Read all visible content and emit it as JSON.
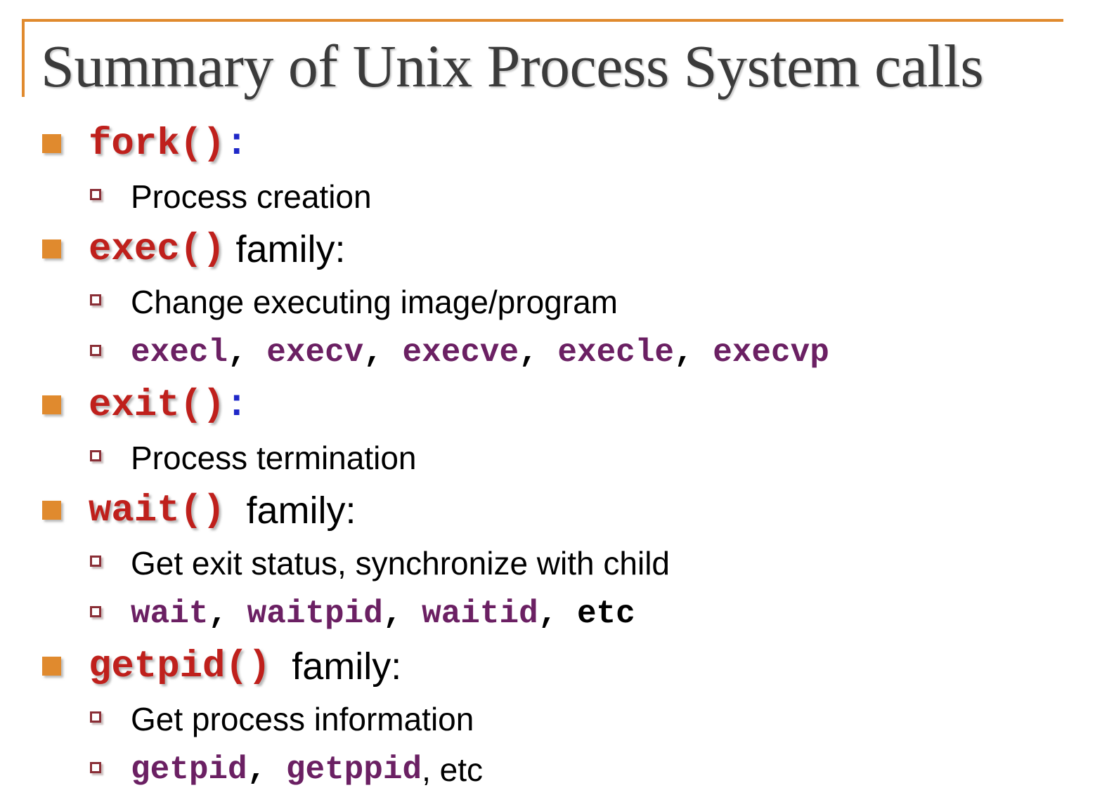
{
  "slide": {
    "title": "Summary of Unix Process System calls",
    "accent_color": "#E08A2E",
    "title_color": "#3B3B3B",
    "code_red_color": "#BF201C",
    "code_purple_color": "#6B2063",
    "colon_blue_color": "#1F28C8",
    "bullet_l1_color": "#E08A2E",
    "bullet_l2_color": "#8A2E36",
    "background_color": "#FFFFFF"
  },
  "outline": {
    "fork": {
      "call": "fork()",
      "colon": ":",
      "sub1": "Process creation"
    },
    "exec": {
      "call": "exec()",
      "suffix": " family:",
      "sub1": "Change executing image/program",
      "sub2": {
        "a": "execl",
        "sep1": ", ",
        "b": "execv",
        "sep2": ", ",
        "c": "execve",
        "sep3": ", ",
        "d": "execle",
        "sep4": ", ",
        "e": "execvp"
      }
    },
    "exit": {
      "call": "exit()",
      "colon": ":",
      "sub1": "Process termination"
    },
    "wait": {
      "call": "wait()",
      "suffix": "  family:",
      "sub1": "Get exit status, synchronize with child",
      "sub2": {
        "a": "wait",
        "sep1": ", ",
        "b": "waitpid",
        "sep2": ", ",
        "c": "waitid",
        "sep3": ", ",
        "d": "etc"
      }
    },
    "getpid": {
      "call": "getpid()",
      "suffix": "  family:",
      "sub1": "Get process information",
      "sub2": {
        "a": "getpid",
        "sep1": ", ",
        "b": "getppid",
        "sep2": ",",
        "c": " etc"
      }
    }
  }
}
